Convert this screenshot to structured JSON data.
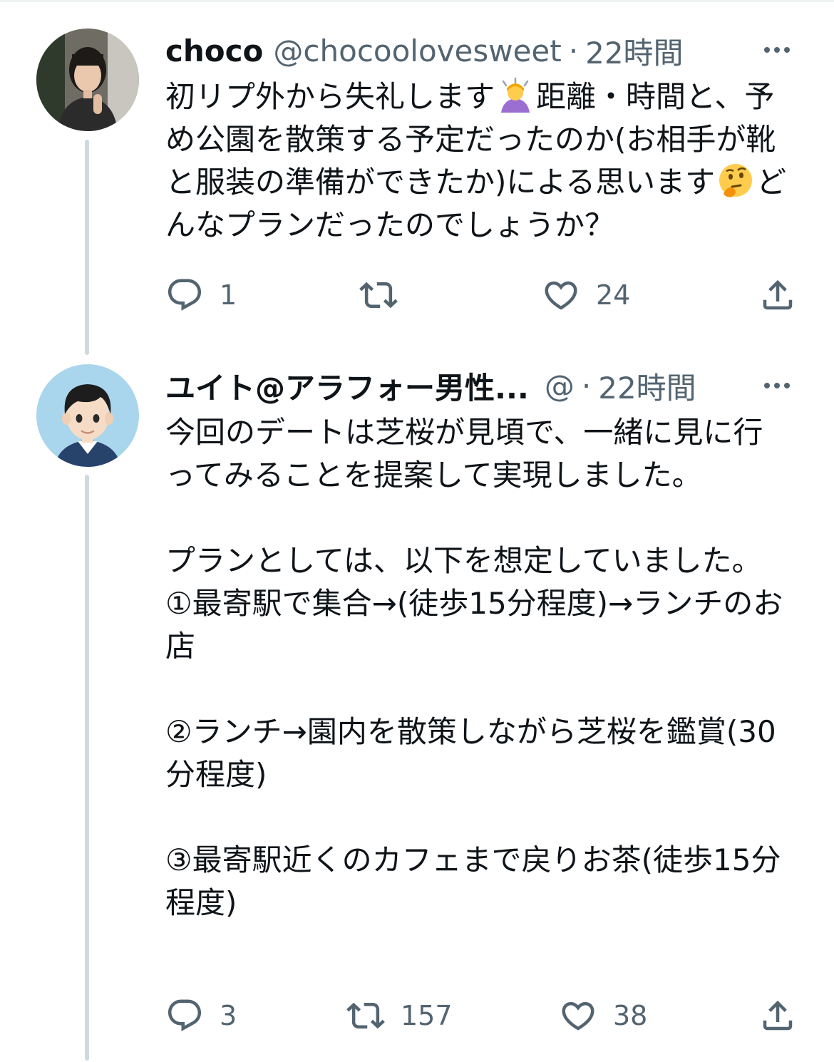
{
  "colors": {
    "text": "#0f1419",
    "secondary": "#536471",
    "thread_line": "#cfd9de"
  },
  "tweets": [
    {
      "name": "choco",
      "handle": "@chocoolovesweet",
      "separator": "·",
      "time": "22時間",
      "text_part1": "初リプ外から失礼します",
      "emoji1": "person-bowing-emoji",
      "text_part2": "距離・時間と、予め公園を散策する予定だったのか(お相手が靴と服装の準備ができたか)による思います",
      "emoji2": "thinking-face-emoji",
      "text_part3": "どんなプランだったのでしょうか？",
      "reply_count": "1",
      "retweet_count": "",
      "like_count": "24"
    },
    {
      "name": "ユイト@アラフォー男性...",
      "handle": "@",
      "separator": "·",
      "time": "22時間",
      "text": "今回のデートは芝桜が見頃で、一緒に見に行ってみることを提案して実現しました。\n\nプランとしては、以下を想定していました。\n①最寄駅で集合→(徒歩15分程度)→ランチのお店\n\n②ランチ→園内を散策しながら芝桜を鑑賞(30分程度)\n\n③最寄駅近くのカフェまで戻りお茶(徒歩15分程度)",
      "reply_count": "3",
      "retweet_count": "157",
      "like_count": "38"
    }
  ]
}
